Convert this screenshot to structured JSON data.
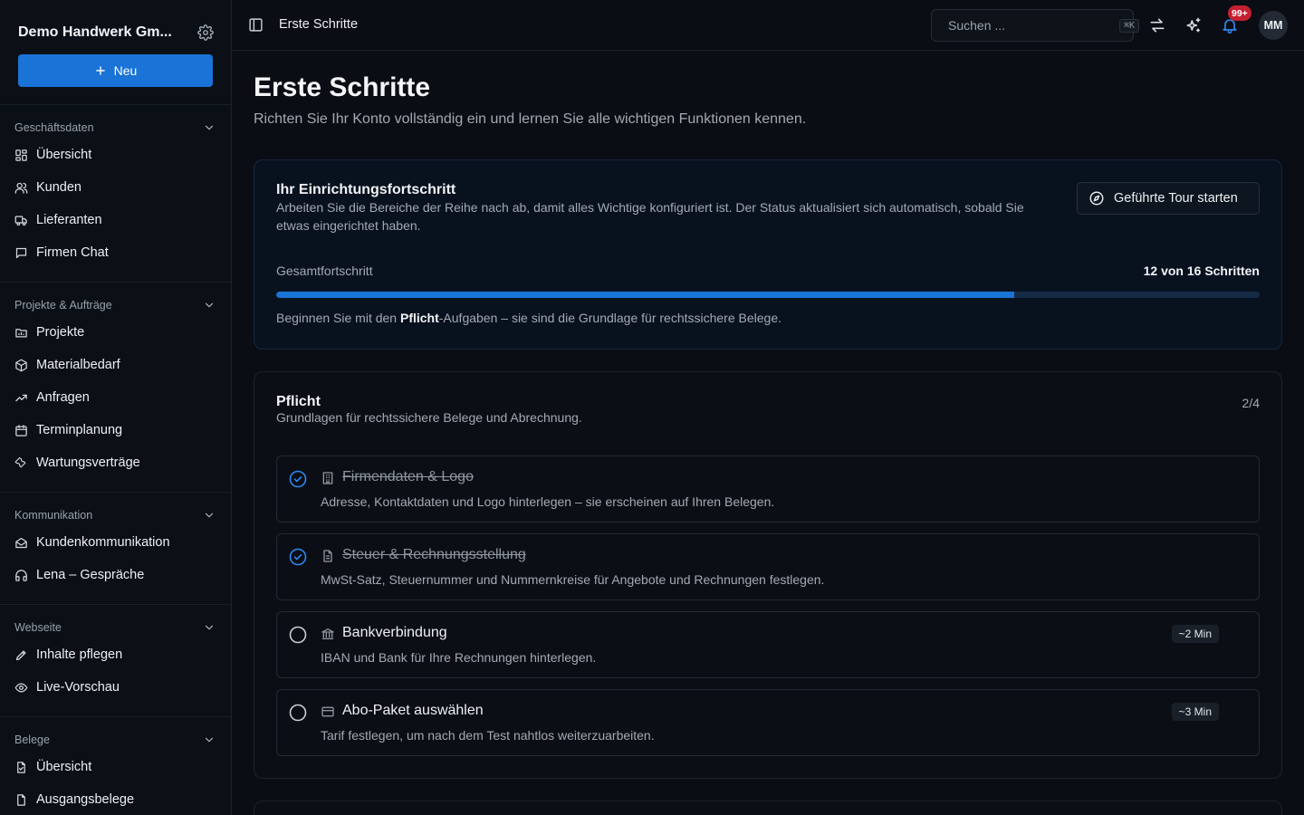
{
  "sidebar": {
    "company_name": "Demo Handwerk Gm...",
    "new_button": "Neu",
    "sections": [
      {
        "title": "Geschäftsdaten",
        "items": [
          "Übersicht",
          "Kunden",
          "Lieferanten",
          "Firmen Chat"
        ]
      },
      {
        "title": "Projekte & Aufträge",
        "items": [
          "Projekte",
          "Materialbedarf",
          "Anfragen",
          "Terminplanung",
          "Wartungsverträge"
        ]
      },
      {
        "title": "Kommunikation",
        "items": [
          "Kundenkommunikation",
          "Lena – Gespräche"
        ]
      },
      {
        "title": "Webseite",
        "items": [
          "Inhalte pflegen",
          "Live-Vorschau"
        ]
      },
      {
        "title": "Belege",
        "items": [
          "Übersicht",
          "Ausgangsbelege"
        ]
      }
    ]
  },
  "topbar": {
    "breadcrumb": "Erste Schritte",
    "search_placeholder": "Suchen ...",
    "search_shortcut": "⌘K",
    "notification_badge": "99+",
    "avatar_initials": "MM"
  },
  "page": {
    "title": "Erste Schritte",
    "subtitle": "Richten Sie Ihr Konto vollständig ein und lernen Sie alle wichtigen Funktionen kennen."
  },
  "progress": {
    "title": "Ihr Einrichtungsfortschritt",
    "description": "Arbeiten Sie die Bereiche der Reihe nach ab, damit alles Wichtige konfiguriert ist. Der Status aktualisiert sich automatisch, sobald Sie etwas eingerichtet haben.",
    "tour_button": "Geführte Tour starten",
    "label": "Gesamtfortschritt",
    "count_text": "12 von 16 Schritten",
    "completed": 12,
    "total": 16,
    "hint_before": "Beginnen Sie mit den ",
    "hint_bold": "Pflicht",
    "hint_after": "-Aufgaben – sie sind die Grundlage für rechtssichere Belege.",
    "accent_color": "#1a73d6"
  },
  "pflicht": {
    "title": "Pflicht",
    "subtitle": "Grundlagen für rechtssichere Belege und Abrechnung.",
    "count": "2/4",
    "tasks": [
      {
        "name": "Firmendaten & Logo",
        "description": "Adresse, Kontaktdaten und Logo hinterlegen – sie erscheinen auf Ihren Belegen.",
        "done": true,
        "icon": "building-icon",
        "duration": ""
      },
      {
        "name": "Steuer & Rechnungsstellung",
        "description": "MwSt-Satz, Steuernummer und Nummernkreise für Angebote und Rechnungen festlegen.",
        "done": true,
        "icon": "document-icon",
        "duration": ""
      },
      {
        "name": "Bankverbindung",
        "description": "IBAN und Bank für Ihre Rechnungen hinterlegen.",
        "done": false,
        "icon": "bank-icon",
        "duration": "~2 Min"
      },
      {
        "name": "Abo-Paket auswählen",
        "description": "Tarif festlegen, um nach dem Test nahtlos weiterzuarbeiten.",
        "done": false,
        "icon": "credit-card-icon",
        "duration": "~3 Min"
      }
    ]
  }
}
